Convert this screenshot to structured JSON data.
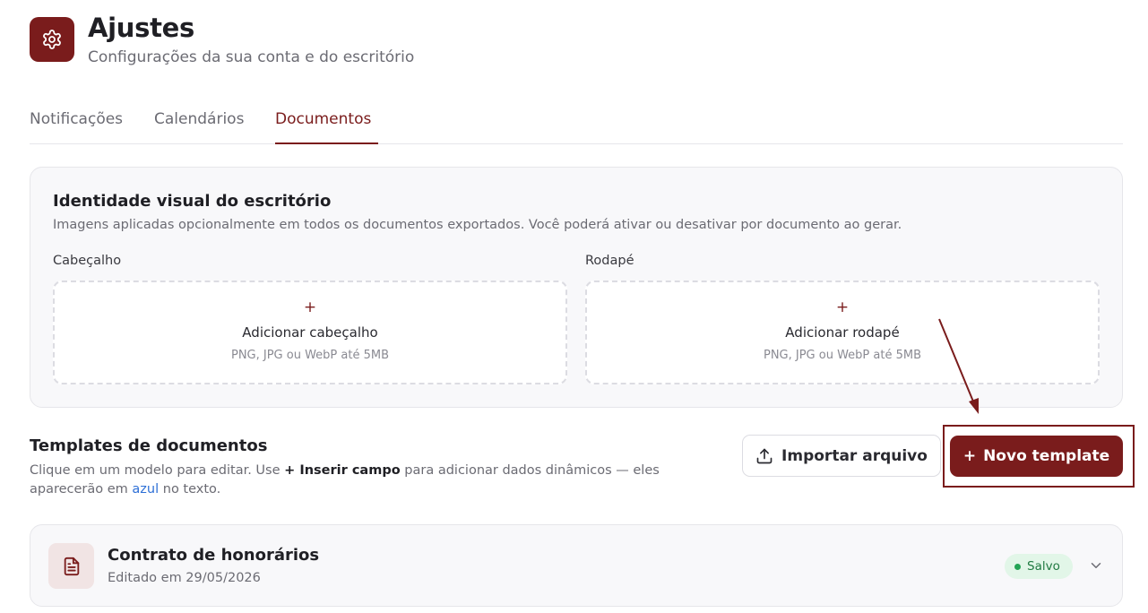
{
  "header": {
    "icon": "gear-icon",
    "title": "Ajustes",
    "subtitle": "Configurações da sua conta e do escritório"
  },
  "tabs": [
    {
      "label": "Notificações",
      "active": false
    },
    {
      "label": "Calendários",
      "active": false
    },
    {
      "label": "Documentos",
      "active": true
    }
  ],
  "identity": {
    "title": "Identidade visual do escritório",
    "description": "Imagens aplicadas opcionalmente em todos os documentos exportados. Você poderá ativar ou desativar por documento ao gerar.",
    "header_field": {
      "label": "Cabeçalho",
      "plus": "+",
      "action": "Adicionar cabeçalho",
      "hint": "PNG, JPG ou WebP até 5MB"
    },
    "footer_field": {
      "label": "Rodapé",
      "plus": "+",
      "action": "Adicionar rodapé",
      "hint": "PNG, JPG ou WebP até 5MB"
    }
  },
  "templates": {
    "title": "Templates de documentos",
    "desc_part1": "Clique em um modelo para editar. Use ",
    "desc_bold": "+ Inserir campo",
    "desc_part2": " para adicionar dados dinâmicos — eles aparecerão em ",
    "desc_blue": "azul",
    "desc_part3": " no texto.",
    "import_label": "Importar arquivo",
    "import_icon": "upload-icon",
    "new_label": "Novo template",
    "new_plus": "+",
    "items": [
      {
        "name": "Contrato de honorários",
        "edited": "Editado em 29/05/2026",
        "status": "Salvo",
        "icon": "document-icon"
      }
    ]
  },
  "colors": {
    "brand": "#7a1c1c",
    "status_saved_bg": "#e2f6e8",
    "status_saved_text": "#217a42",
    "link_blue": "#2d6fd6"
  }
}
